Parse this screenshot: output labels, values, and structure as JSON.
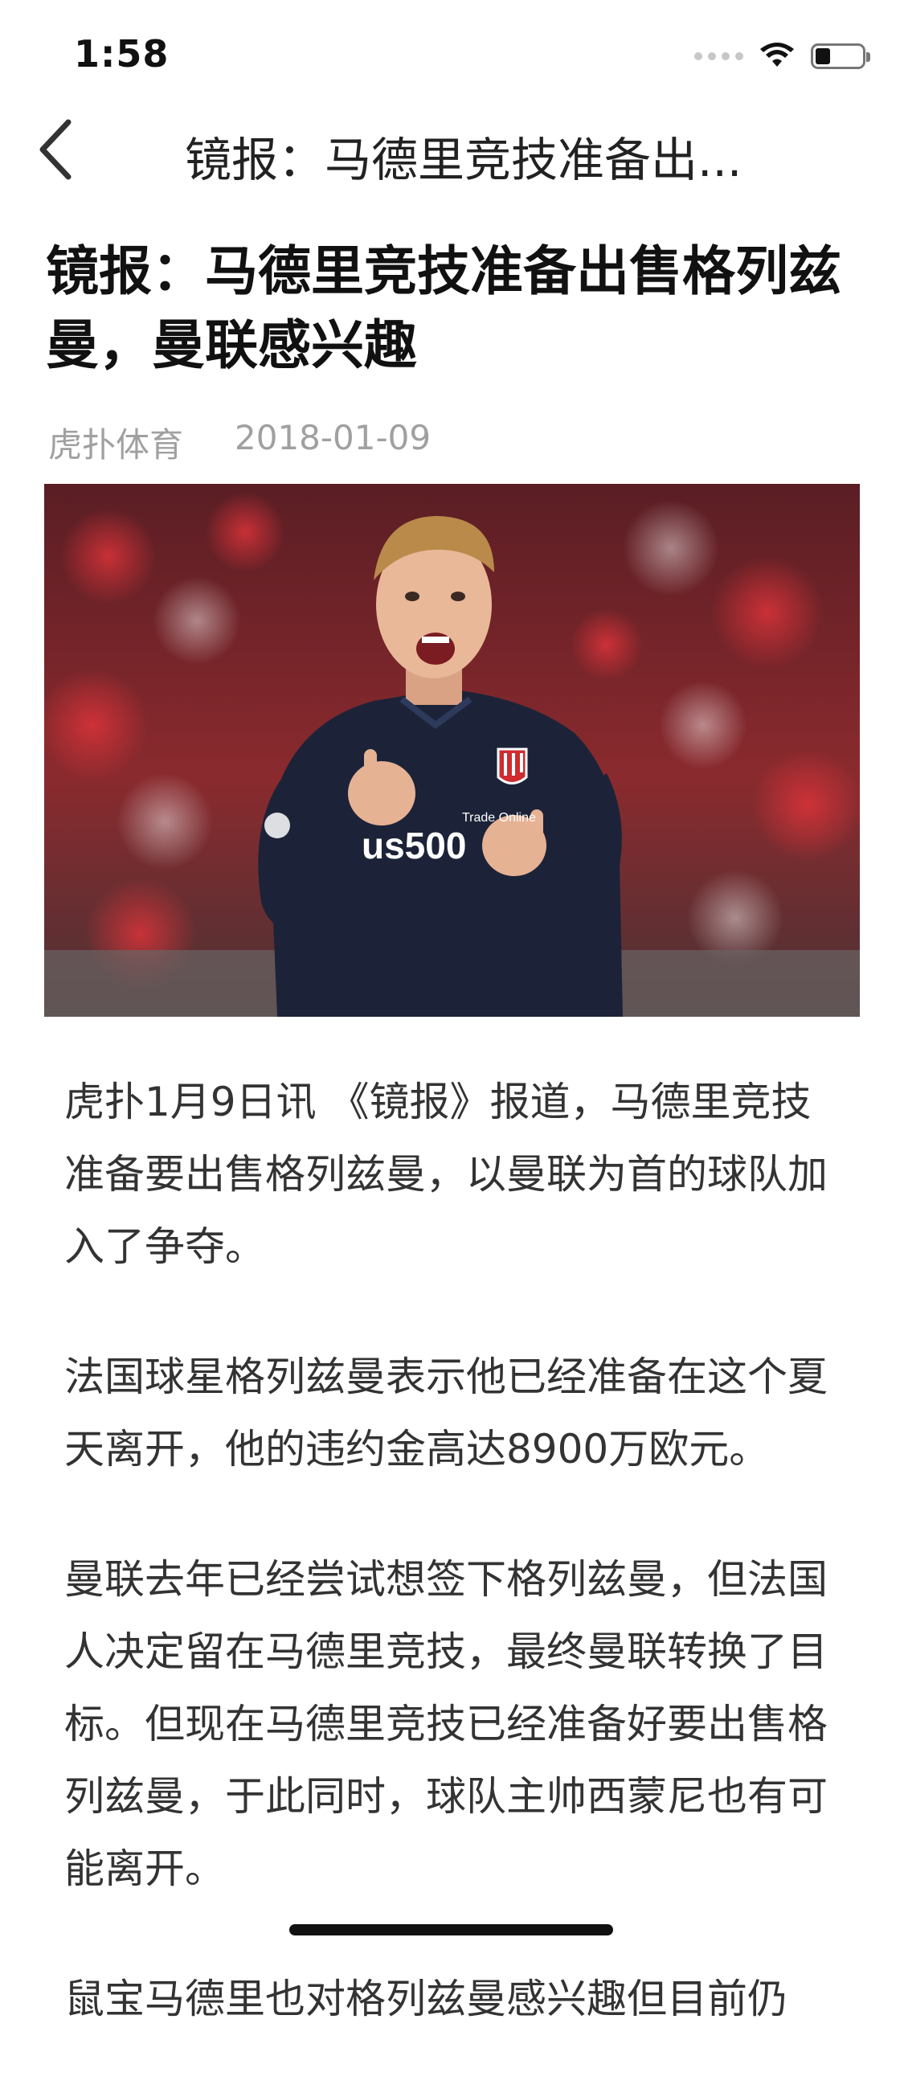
{
  "status_bar": {
    "time": "1:58"
  },
  "nav": {
    "title": "镜报：马德里竞技准备出..."
  },
  "article": {
    "title": "镜报：马德里竞技准备出售格列兹曼，曼联感兴趣",
    "source": "虎扑体育",
    "date": "2018-01-09",
    "paragraphs": [
      "虎扑1月9日讯 《镜报》报道，马德里竞技准备要出售格列兹曼，以曼联为首的球队加入了争夺。",
      "法国球星格列兹曼表示他已经准备在这个夏天离开，他的违约金高达8900万欧元。",
      "曼联去年已经尝试想签下格列兹曼，但法国人决定留在马德里竞技，最终曼联转换了目标。但现在马德里竞技已经准备好要出售格列兹曼，于此同时，球队主帅西蒙尼也有可能离开。",
      "鼠宝马德里也对格列兹曼感兴趣但目前仍"
    ]
  },
  "hero_image": {
    "sponsor_small": "Trade Online",
    "sponsor": "us500"
  },
  "icons": {
    "back": "chevron-left-icon",
    "wifi": "wifi-icon",
    "battery": "battery-icon",
    "signal": "signal-icon"
  },
  "colors": {
    "background": "#ffffff",
    "title": "#111111",
    "meta": "#a0a0a0",
    "body": "#333333"
  }
}
